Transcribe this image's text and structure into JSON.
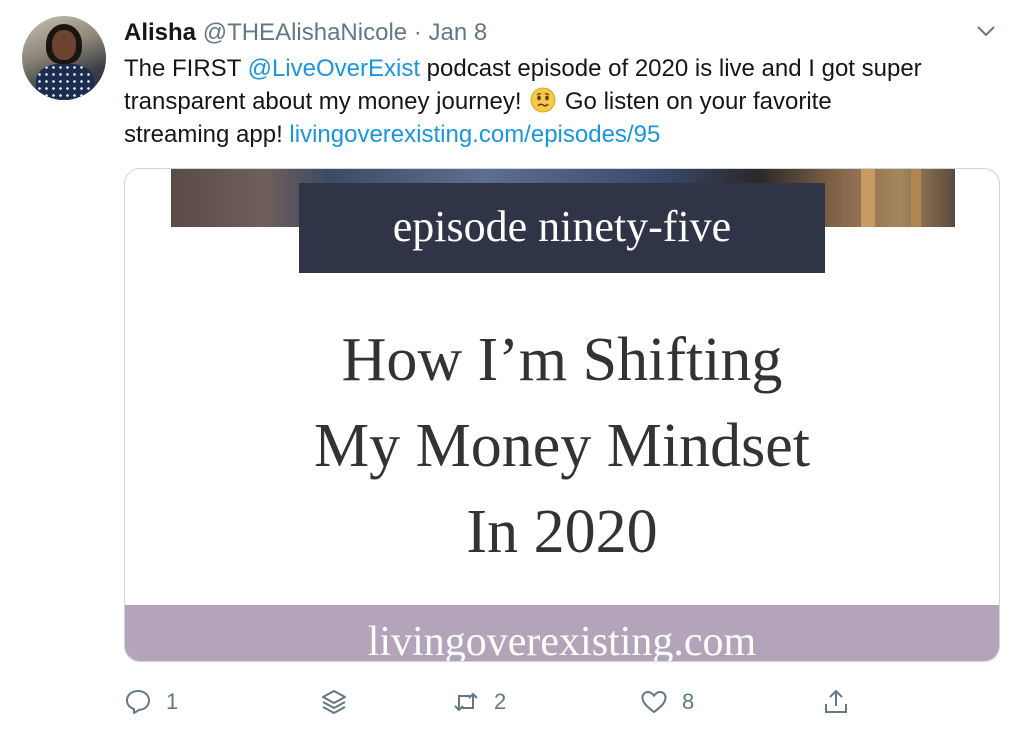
{
  "tweet": {
    "author_name": "Alisha",
    "handle": "@THEAlishaNicole",
    "separator": "·",
    "date": "Jan 8",
    "text": {
      "line1_a": "The FIRST ",
      "mention": "@LiveOverExist",
      "line1_b": " podcast episode of 2020 is live and I got super",
      "line2_a": "transparent about my money journey! ",
      "line2_b": " Go listen on your favorite",
      "line3_a": "streaming app! ",
      "url": "livingoverexisting.com/episodes/95"
    }
  },
  "card": {
    "episode": "episode ninety-five",
    "headline": [
      "How I’m Shifting",
      "My Money Mindset",
      "In 2020"
    ],
    "site": "livingoverexisting.com"
  },
  "actions": {
    "reply_count": "1",
    "retweet_count": "2",
    "like_count": "8"
  },
  "icons": [
    "chevron-down-icon",
    "reply-icon",
    "stack-icon",
    "retweet-icon",
    "heart-icon",
    "share-icon",
    "emoji-icon"
  ]
}
